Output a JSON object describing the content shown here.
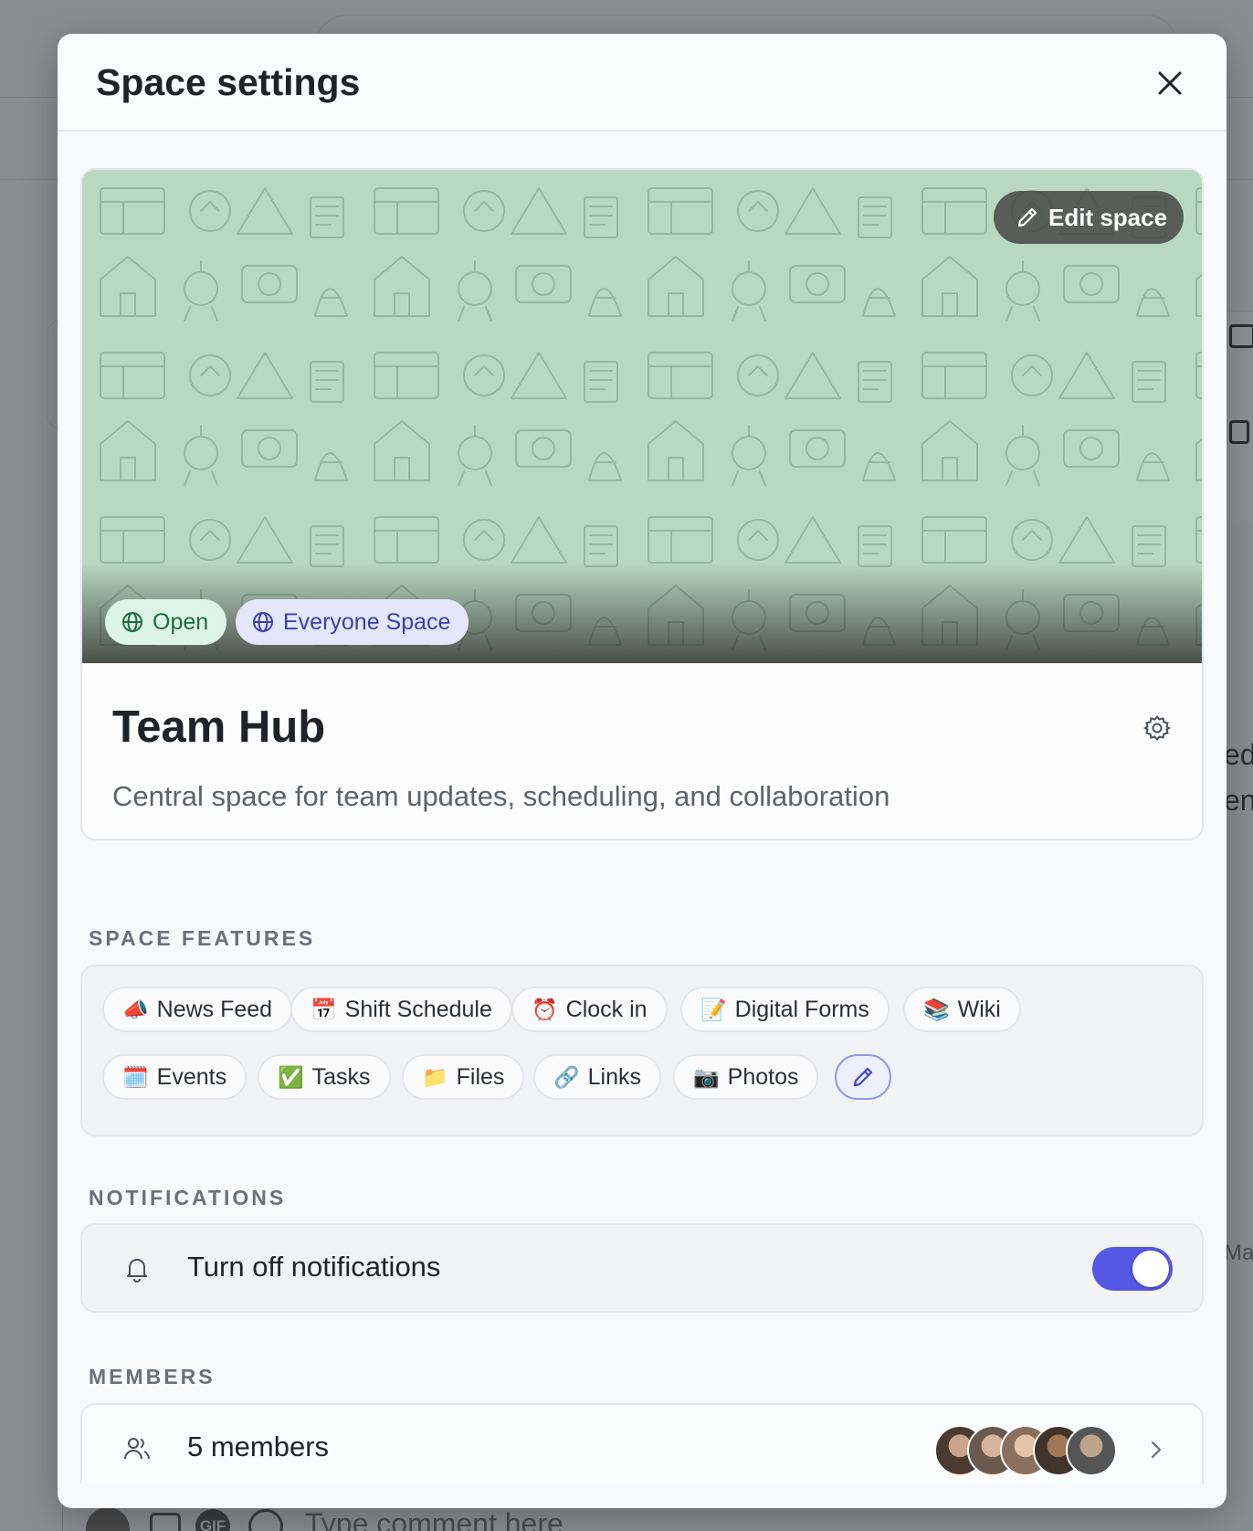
{
  "background": {
    "right_fragments": [
      "ed",
      "en",
      "Ma"
    ],
    "comment_placeholder": "Type comment here",
    "gif_label": "GIF"
  },
  "modal": {
    "title": "Space settings"
  },
  "space": {
    "edit_label": "Edit space",
    "badges": [
      {
        "label": "Open",
        "icon": "globe-icon"
      },
      {
        "label": "Everyone Space",
        "icon": "globe-icon"
      }
    ],
    "name": "Team Hub",
    "description": "Central space for team updates, scheduling, and collaboration"
  },
  "features": {
    "label": "SPACE FEATURES",
    "items": [
      {
        "emoji": "📣",
        "label": "News Feed"
      },
      {
        "emoji": "📅",
        "label": "Shift Schedule"
      },
      {
        "emoji": "⏰",
        "label": "Clock in"
      },
      {
        "emoji": "📝",
        "label": "Digital Forms"
      },
      {
        "emoji": "📚",
        "label": "Wiki"
      },
      {
        "emoji": "🗓️",
        "label": "Events"
      },
      {
        "emoji": "✅",
        "label": "Tasks"
      },
      {
        "emoji": "📁",
        "label": "Files"
      },
      {
        "emoji": "🔗",
        "label": "Links"
      },
      {
        "emoji": "📷",
        "label": "Photos"
      }
    ]
  },
  "notifications": {
    "label": "NOTIFICATIONS",
    "text": "Turn off notifications",
    "enabled": true
  },
  "members": {
    "label": "MEMBERS",
    "text": "5 members"
  },
  "colors": {
    "accent": "#5558e3",
    "cover": "#b9d8c2"
  }
}
